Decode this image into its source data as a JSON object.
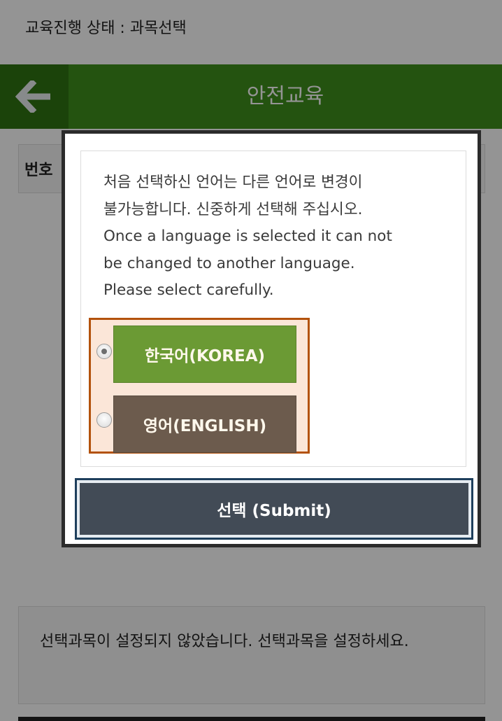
{
  "status": {
    "text": "교육진행 상태 : 과목선택"
  },
  "header": {
    "title": "안전교육",
    "back_icon": "arrow-left-icon"
  },
  "table": {
    "col1": "번호"
  },
  "notice": {
    "text": "선택과목이 설정되지 않았습니다. 선택과목을 설정하세요."
  },
  "modal": {
    "message_lines": [
      "처음 선택하신 언어는 다른 언어로 변경이",
      "불가능합니다. 신중하게 선택해 주십시오.",
      "Once a language is selected it can not",
      "be changed to another language.",
      "Please select carefully."
    ],
    "options": [
      {
        "label": "한국어(KOREA)",
        "selected": true
      },
      {
        "label": "영어(ENGLISH)",
        "selected": false
      }
    ],
    "submit_label": "선택 (Submit)"
  },
  "colors": {
    "header_bg": "#3f8f1c",
    "korea_btn": "#6b9a34",
    "english_btn": "#6c5b4d",
    "submit_btn": "#424b56",
    "selection_border": "#b3520c"
  }
}
